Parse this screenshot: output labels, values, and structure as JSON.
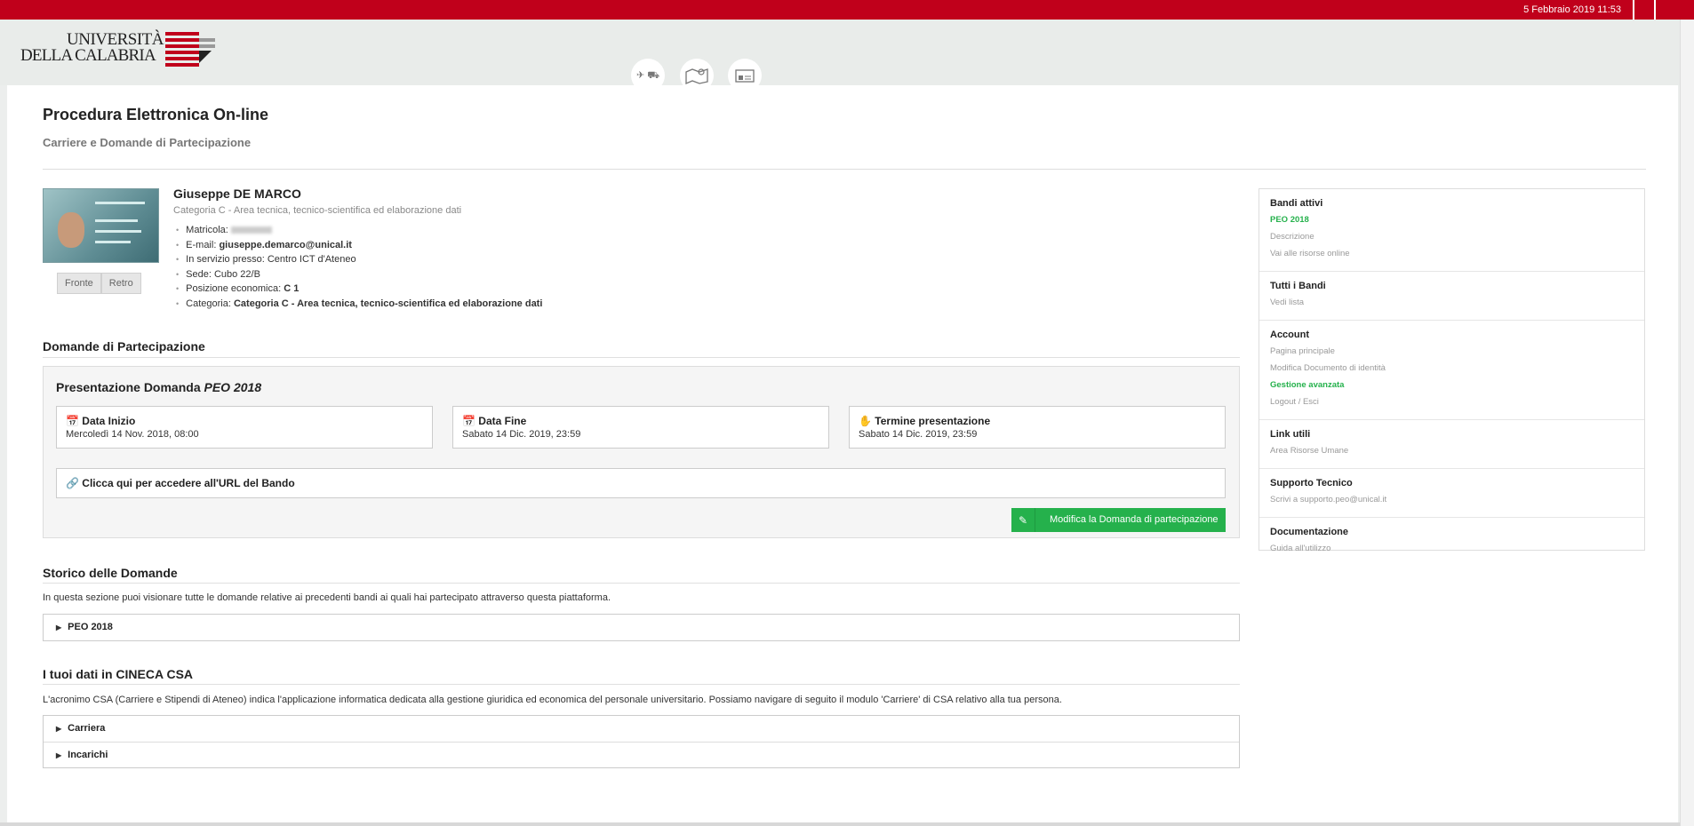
{
  "topbar": {
    "datetime": "5 Febbraio 2019 11:53"
  },
  "brand": {
    "line1": "UNIVERSITÀ",
    "line2": "DELLA CALABRIA"
  },
  "header_icons": [
    "flight-icon",
    "map-icon",
    "id-card-icon"
  ],
  "page": {
    "title": "Procedura Elettronica On-line",
    "subtitle": "Carriere e Domande di Partecipazione"
  },
  "profile": {
    "name": "Giuseppe DE MARCO",
    "category_line": "Categoria C - Area tecnica, tecnico-scientifica ed elaborazione dati",
    "photo_buttons": [
      "Fronte",
      "Retro"
    ],
    "matricola_label": "Matricola:",
    "email_label": "E-mail:",
    "email": "giuseppe.demarco@unical.it",
    "servizio": "In servizio presso: Centro ICT d'Ateneo",
    "sede": "Sede: Cubo 22/B",
    "posizione_label": "Posizione economica:",
    "posizione": "C 1",
    "categoria_label": "Categoria:",
    "categoria": "Categoria C - Area tecnica, tecnico-scientifica ed elaborazione dati"
  },
  "domande": {
    "heading": "Domande di Partecipazione",
    "panel_title_prefix": "Presentazione Domanda",
    "panel_title_em": "PEO 2018",
    "boxes": [
      {
        "label": "Data Inizio",
        "value": "Mercoledì 14 Nov. 2018, 08:00",
        "icon": "calendar-icon"
      },
      {
        "label": "Data Fine",
        "value": "Sabato 14 Dic. 2019, 23:59",
        "icon": "calendar-icon"
      },
      {
        "label": "Termine presentazione",
        "value": "Sabato 14 Dic. 2019, 23:59",
        "icon": "hand-icon"
      }
    ],
    "url_link": "Clicca qui per accedere all'URL del Bando",
    "edit_button": "Modifica la Domanda di partecipazione"
  },
  "storico": {
    "heading": "Storico delle Domande",
    "description": "In questa sezione puoi visionare tutte le domande relative ai precedenti bandi ai quali hai partecipato attraverso questa piattaforma.",
    "items": [
      "PEO 2018"
    ]
  },
  "cineca": {
    "heading": "I tuoi dati in CINECA CSA",
    "description": "L'acronimo CSA (Carriere e Stipendi di Ateneo) indica l'applicazione informatica dedicata alla gestione giuridica ed economica del personale universitario. Possiamo navigare di seguito il modulo 'Carriere' di CSA relativo alla tua persona.",
    "items": [
      "Carriera",
      "Incarichi"
    ]
  },
  "sidebar": [
    {
      "heading": "Bandi attivi",
      "links": [
        {
          "text": "PEO 2018",
          "active": true
        },
        {
          "text": "Descrizione"
        },
        {
          "text": "Vai alle risorse online"
        }
      ]
    },
    {
      "heading": "Tutti i Bandi",
      "links": [
        {
          "text": "Vedi lista"
        }
      ]
    },
    {
      "heading": "Account",
      "links": [
        {
          "text": "Pagina principale"
        },
        {
          "text": "Modifica Documento di identità"
        },
        {
          "text": "Gestione avanzata",
          "active": true
        },
        {
          "text": "Logout / Esci"
        }
      ]
    },
    {
      "heading": "Link utili",
      "links": [
        {
          "text": "Area Risorse Umane"
        }
      ]
    },
    {
      "heading": "Supporto Tecnico",
      "links": [
        {
          "text": "Scrivi a supporto.peo@unical.it"
        }
      ]
    },
    {
      "heading": "Documentazione",
      "links": [
        {
          "text": "Guida all'utilizzo"
        }
      ]
    }
  ],
  "colors": {
    "brand_red": "#c0001b",
    "accent_green": "#25b14c"
  }
}
